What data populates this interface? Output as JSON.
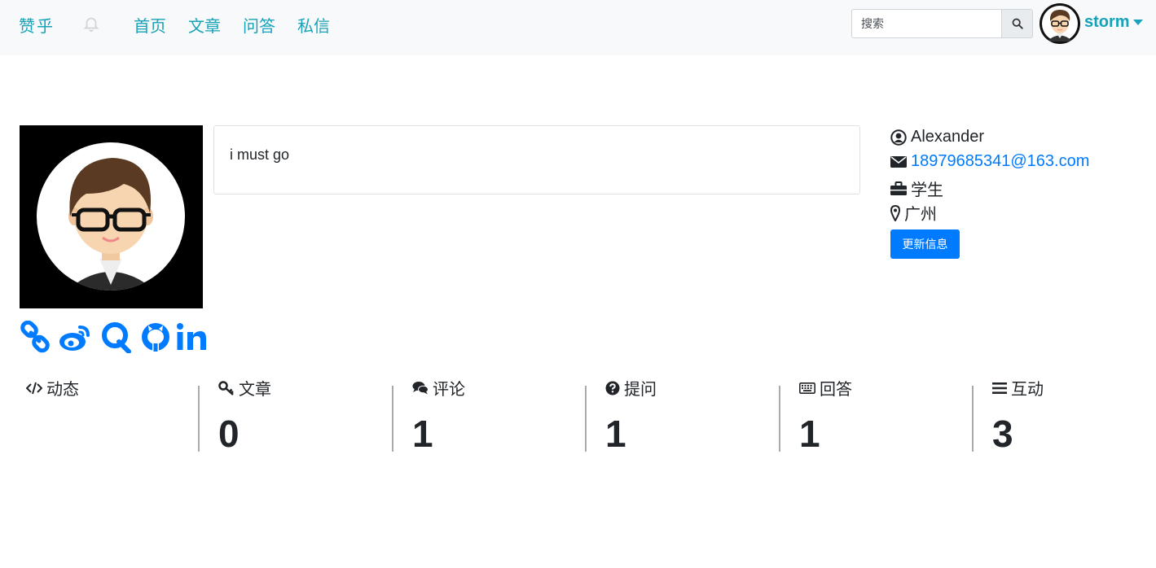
{
  "navbar": {
    "brand": "赞乎",
    "links": [
      "首页",
      "文章",
      "问答",
      "私信"
    ],
    "search_placeholder": "搜索",
    "user_name": "storm",
    "icons": [
      "bell-icon",
      "search-icon",
      "caret-down-icon"
    ]
  },
  "profile": {
    "motto": "i must go",
    "name": "Alexander",
    "email": "18979685341@163.com",
    "job": "学生",
    "location": "广州",
    "update_button": "更新信息",
    "social_icons": [
      "link-icon",
      "weibo-icon",
      "qq-icon",
      "github-icon",
      "linkedin-icon"
    ]
  },
  "stats": [
    {
      "label": "动态",
      "value": "",
      "icon": "code-icon"
    },
    {
      "label": "文章",
      "value": "0",
      "icon": "key-icon"
    },
    {
      "label": "评论",
      "value": "1",
      "icon": "comments-icon"
    },
    {
      "label": "提问",
      "value": "1",
      "icon": "question-circle-icon"
    },
    {
      "label": "回答",
      "value": "1",
      "icon": "keyboard-icon"
    },
    {
      "label": "互动",
      "value": "3",
      "icon": "bars-icon"
    }
  ],
  "colors": {
    "nav_link": "#17a2b8",
    "primary": "#007bff",
    "navbar_bg": "#f8f9fa"
  }
}
